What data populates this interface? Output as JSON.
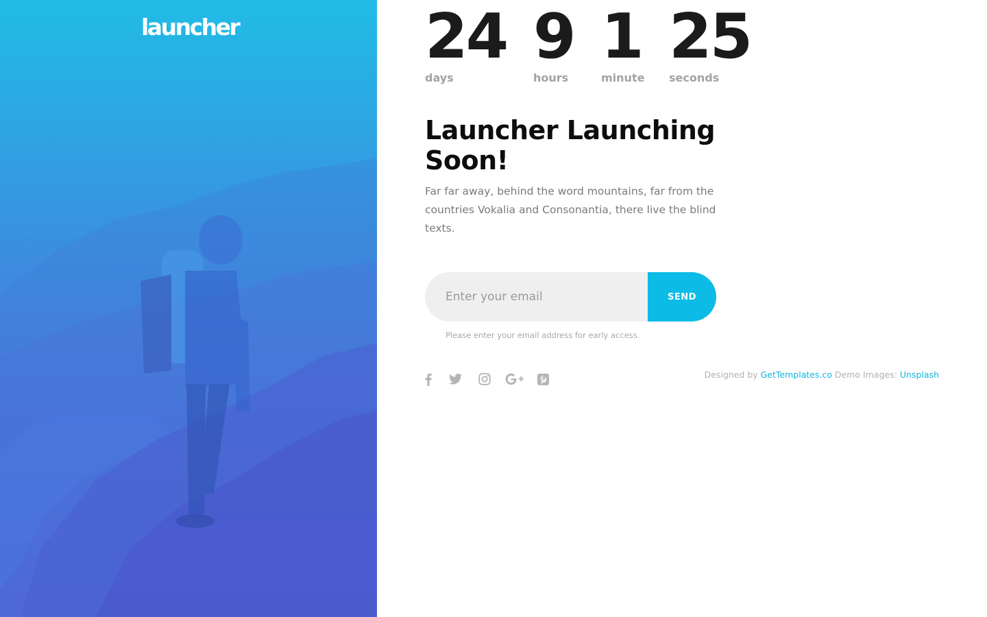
{
  "brand": {
    "logo_text": "launcher"
  },
  "countdown": {
    "units": [
      {
        "value": "24",
        "label": "days"
      },
      {
        "value": "9",
        "label": "hours"
      },
      {
        "value": "1",
        "label": "minute"
      },
      {
        "value": "25",
        "label": "seconds"
      }
    ]
  },
  "hero": {
    "title": "Launcher Launching Soon!",
    "description": "Far far away, behind the word mountains, far from the countries Vokalia and Consonantia, there live the blind texts."
  },
  "subscribe": {
    "email_placeholder": "Enter your email",
    "email_value": "",
    "send_label": "SEND",
    "hint": "Please enter your email address for early access."
  },
  "social": {
    "icons": [
      "facebook-icon",
      "twitter-icon",
      "instagram-icon",
      "google-plus-icon",
      "pinterest-icon"
    ]
  },
  "credits": {
    "designed_by_prefix": "Designed by ",
    "designer_link": "GetTemplates.co",
    "demo_prefix": " Demo Images: ",
    "images_link": "Unsplash"
  },
  "colors": {
    "accent": "#0cbbe6",
    "gradient_top": "#21bce6",
    "gradient_bottom": "#5a55d6",
    "heading": "#0d0d0d",
    "muted": "#a3a3a3"
  }
}
